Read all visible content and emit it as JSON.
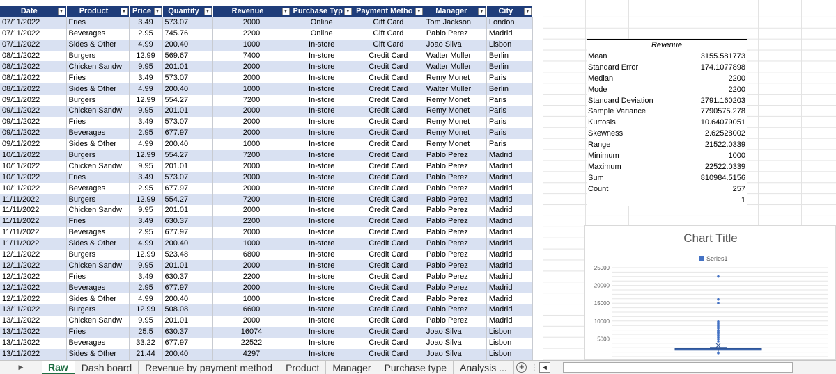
{
  "table": {
    "headers": [
      "Date",
      "Product",
      "Price",
      "Quantity",
      "Revenue",
      "Purchase Typ",
      "Payment Metho",
      "Manager",
      "City"
    ],
    "rows": [
      [
        "07/11/2022",
        "Fries",
        "3.49",
        "573.07",
        "2000",
        "Online",
        "Gift Card",
        "Tom Jackson",
        "London"
      ],
      [
        "07/11/2022",
        "Beverages",
        "2.95",
        "745.76",
        "2200",
        "Online",
        "Gift Card",
        "Pablo Perez",
        "Madrid"
      ],
      [
        "07/11/2022",
        "Sides & Other",
        "4.99",
        "200.40",
        "1000",
        "In-store",
        "Gift Card",
        "Joao Silva",
        "Lisbon"
      ],
      [
        "08/11/2022",
        "Burgers",
        "12.99",
        "569.67",
        "7400",
        "In-store",
        "Credit Card",
        "Walter Muller",
        "Berlin"
      ],
      [
        "08/11/2022",
        "Chicken Sandw",
        "9.95",
        "201.01",
        "2000",
        "In-store",
        "Credit Card",
        "Walter Muller",
        "Berlin"
      ],
      [
        "08/11/2022",
        "Fries",
        "3.49",
        "573.07",
        "2000",
        "In-store",
        "Credit Card",
        "Remy Monet",
        "Paris"
      ],
      [
        "08/11/2022",
        "Sides & Other",
        "4.99",
        "200.40",
        "1000",
        "In-store",
        "Credit Card",
        "Walter Muller",
        "Berlin"
      ],
      [
        "09/11/2022",
        "Burgers",
        "12.99",
        "554.27",
        "7200",
        "In-store",
        "Credit Card",
        "Remy Monet",
        "Paris"
      ],
      [
        "09/11/2022",
        "Chicken Sandw",
        "9.95",
        "201.01",
        "2000",
        "In-store",
        "Credit Card",
        "Remy Monet",
        "Paris"
      ],
      [
        "09/11/2022",
        "Fries",
        "3.49",
        "573.07",
        "2000",
        "In-store",
        "Credit Card",
        "Remy Monet",
        "Paris"
      ],
      [
        "09/11/2022",
        "Beverages",
        "2.95",
        "677.97",
        "2000",
        "In-store",
        "Credit Card",
        "Remy Monet",
        "Paris"
      ],
      [
        "09/11/2022",
        "Sides & Other",
        "4.99",
        "200.40",
        "1000",
        "In-store",
        "Credit Card",
        "Remy Monet",
        "Paris"
      ],
      [
        "10/11/2022",
        "Burgers",
        "12.99",
        "554.27",
        "7200",
        "In-store",
        "Credit Card",
        "Pablo Perez",
        "Madrid"
      ],
      [
        "10/11/2022",
        "Chicken Sandw",
        "9.95",
        "201.01",
        "2000",
        "In-store",
        "Credit Card",
        "Pablo Perez",
        "Madrid"
      ],
      [
        "10/11/2022",
        "Fries",
        "3.49",
        "573.07",
        "2000",
        "In-store",
        "Credit Card",
        "Pablo Perez",
        "Madrid"
      ],
      [
        "10/11/2022",
        "Beverages",
        "2.95",
        "677.97",
        "2000",
        "In-store",
        "Credit Card",
        "Pablo Perez",
        "Madrid"
      ],
      [
        "11/11/2022",
        "Burgers",
        "12.99",
        "554.27",
        "7200",
        "In-store",
        "Credit Card",
        "Pablo Perez",
        "Madrid"
      ],
      [
        "11/11/2022",
        "Chicken Sandw",
        "9.95",
        "201.01",
        "2000",
        "In-store",
        "Credit Card",
        "Pablo Perez",
        "Madrid"
      ],
      [
        "11/11/2022",
        "Fries",
        "3.49",
        "630.37",
        "2200",
        "In-store",
        "Credit Card",
        "Pablo Perez",
        "Madrid"
      ],
      [
        "11/11/2022",
        "Beverages",
        "2.95",
        "677.97",
        "2000",
        "In-store",
        "Credit Card",
        "Pablo Perez",
        "Madrid"
      ],
      [
        "11/11/2022",
        "Sides & Other",
        "4.99",
        "200.40",
        "1000",
        "In-store",
        "Credit Card",
        "Pablo Perez",
        "Madrid"
      ],
      [
        "12/11/2022",
        "Burgers",
        "12.99",
        "523.48",
        "6800",
        "In-store",
        "Credit Card",
        "Pablo Perez",
        "Madrid"
      ],
      [
        "12/11/2022",
        "Chicken Sandw",
        "9.95",
        "201.01",
        "2000",
        "In-store",
        "Credit Card",
        "Pablo Perez",
        "Madrid"
      ],
      [
        "12/11/2022",
        "Fries",
        "3.49",
        "630.37",
        "2200",
        "In-store",
        "Credit Card",
        "Pablo Perez",
        "Madrid"
      ],
      [
        "12/11/2022",
        "Beverages",
        "2.95",
        "677.97",
        "2000",
        "In-store",
        "Credit Card",
        "Pablo Perez",
        "Madrid"
      ],
      [
        "12/11/2022",
        "Sides & Other",
        "4.99",
        "200.40",
        "1000",
        "In-store",
        "Credit Card",
        "Pablo Perez",
        "Madrid"
      ],
      [
        "13/11/2022",
        "Burgers",
        "12.99",
        "508.08",
        "6600",
        "In-store",
        "Credit Card",
        "Pablo Perez",
        "Madrid"
      ],
      [
        "13/11/2022",
        "Chicken Sandw",
        "9.95",
        "201.01",
        "2000",
        "In-store",
        "Credit Card",
        "Pablo Perez",
        "Madrid"
      ],
      [
        "13/11/2022",
        "Fries",
        "25.5",
        "630.37",
        "16074",
        "In-store",
        "Credit Card",
        "Joao Silva",
        "Lisbon"
      ],
      [
        "13/11/2022",
        "Beverages",
        "33.22",
        "677.97",
        "22522",
        "In-store",
        "Credit Card",
        "Joao Silva",
        "Lisbon"
      ],
      [
        "13/11/2022",
        "Sides & Other",
        "21.44",
        "200.40",
        "4297",
        "In-store",
        "Credit Card",
        "Joao Silva",
        "Lisbon"
      ]
    ]
  },
  "stats": {
    "title": "Revenue",
    "rows": [
      {
        "label": "Mean",
        "value": "3155.581773"
      },
      {
        "label": "Standard Error",
        "value": "174.1077898"
      },
      {
        "label": "Median",
        "value": "2200"
      },
      {
        "label": "Mode",
        "value": "2200"
      },
      {
        "label": "Standard Deviation",
        "value": "2791.160203"
      },
      {
        "label": "Sample Variance",
        "value": "7790575.278"
      },
      {
        "label": "Kurtosis",
        "value": "10.64079051"
      },
      {
        "label": "Skewness",
        "value": "2.62528002"
      },
      {
        "label": "Range",
        "value": "21522.0339"
      },
      {
        "label": "Minimum",
        "value": "1000"
      },
      {
        "label": "Maximum",
        "value": "22522.0339"
      },
      {
        "label": "Sum",
        "value": "810984.5156"
      },
      {
        "label": "Count",
        "value": "257"
      }
    ],
    "extra_value": "1"
  },
  "chart_data": {
    "type": "scatter",
    "title": "Chart Title",
    "legend": [
      "Series1"
    ],
    "legend_position": "top",
    "yticks": [
      "25000",
      "20000",
      "15000",
      "10000",
      "5000"
    ],
    "ylim": [
      0,
      25000
    ],
    "grid": true,
    "series": [
      {
        "name": "Series1",
        "box": {
          "min": 1000,
          "q1": 2000,
          "median": 2200,
          "q3": 2200,
          "max": 2200,
          "mean": 3155.58
        },
        "outliers": [
          22522,
          16074,
          15000,
          9800,
          9200,
          8600,
          8000,
          7400,
          7200,
          6800,
          6600,
          6000,
          5400,
          4900,
          4297,
          1000
        ]
      }
    ]
  },
  "tabs": {
    "items": [
      "Raw",
      "Dash board",
      "Revenue by payment method",
      "Product",
      "Manager",
      "Purchase type",
      "Analysis ..."
    ],
    "active": 0,
    "add_label": "+",
    "more_label": "⋮",
    "scroll_left_label": "◀",
    "nav_label": "▶"
  },
  "colors": {
    "header_bg": "#1f3d7a",
    "band": "#d9e1f2",
    "series": "#4472c4",
    "active_tab": "#1f6e43"
  }
}
